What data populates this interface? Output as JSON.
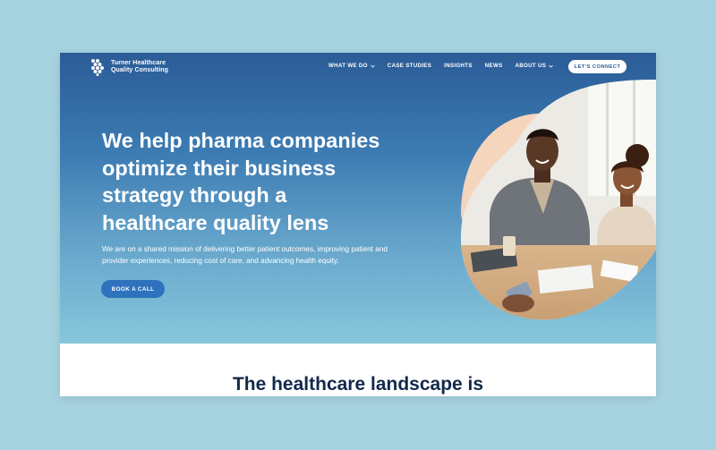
{
  "brand": {
    "name_line1": "Turner Healthcare",
    "name_line2": "Quality Consulting",
    "logo_icon": "tq-logo-icon"
  },
  "nav": {
    "items": [
      {
        "label": "WHAT WE DO",
        "has_dropdown": true
      },
      {
        "label": "CASE STUDIES",
        "has_dropdown": false
      },
      {
        "label": "INSIGHTS",
        "has_dropdown": false
      },
      {
        "label": "NEWS",
        "has_dropdown": false
      },
      {
        "label": "ABOUT US",
        "has_dropdown": true
      }
    ],
    "cta_label": "LET'S CONNECT"
  },
  "hero": {
    "headline_lines": [
      "We help pharma companies",
      "optimize their business",
      "strategy through a",
      "healthcare quality lens"
    ],
    "subcopy": "We are on a shared mission of delivering better patient outcomes, improving patient and provider experiences, reducing cost of care, and advancing health equity.",
    "cta_label": "BOOK A CALL"
  },
  "section": {
    "title": "The healthcare landscape is"
  },
  "colors": {
    "page_bg": "#a7d3e0",
    "hero_top": "#2b5c97",
    "hero_bottom": "#87c7dc",
    "accent_button": "#2e72bd",
    "title_navy": "#13294b",
    "peach_shape": "#f6d5bd"
  }
}
